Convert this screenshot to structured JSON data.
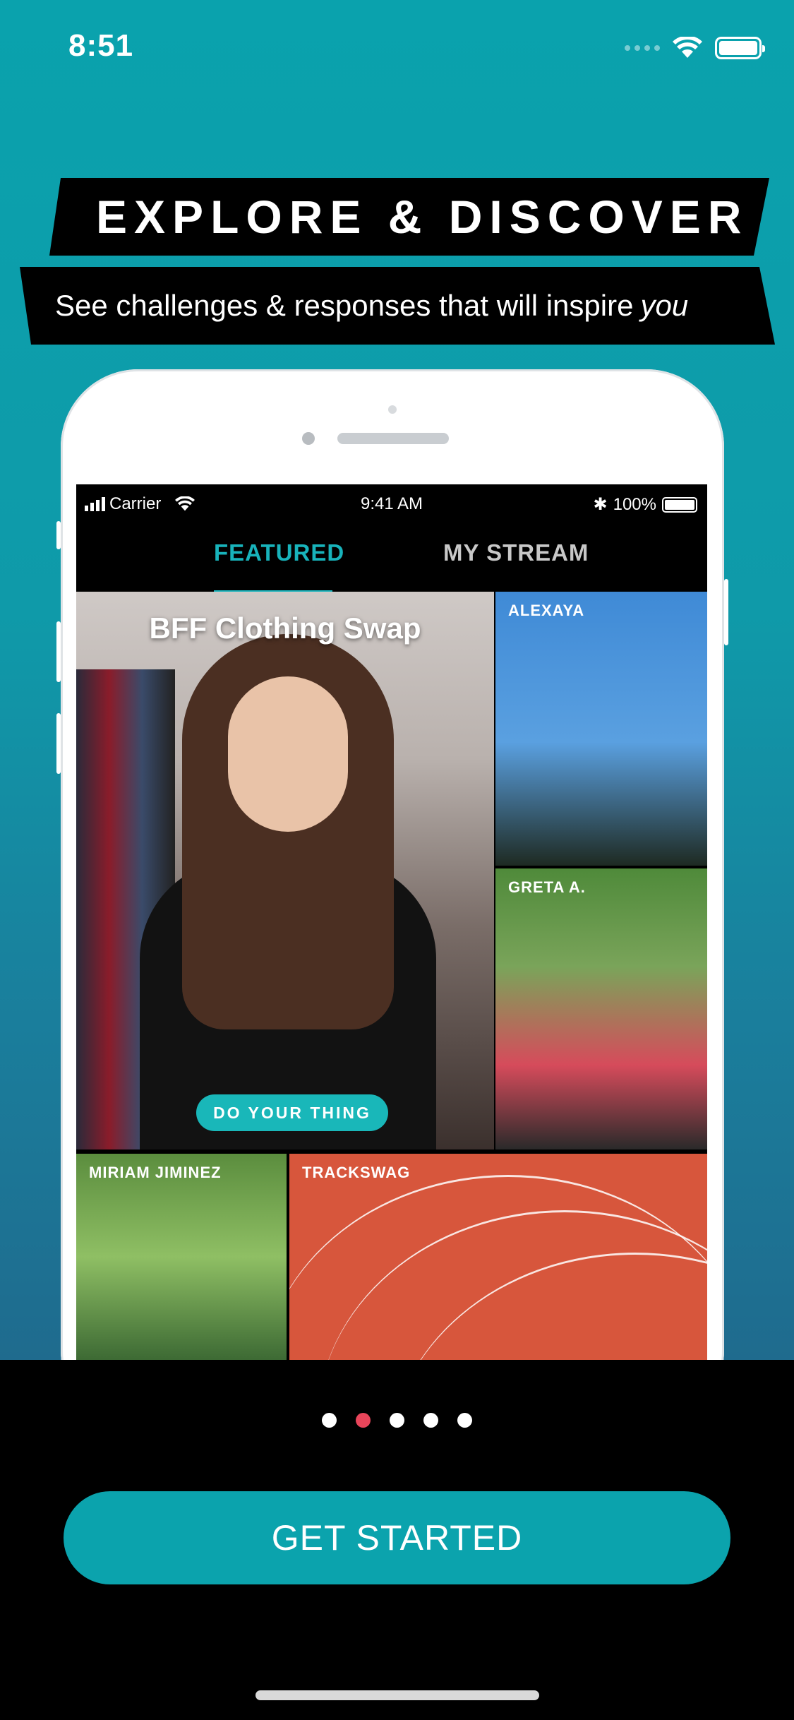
{
  "status_bar": {
    "time": "8:51"
  },
  "banner": {
    "title": "EXPLORE & DISCOVER",
    "subtitle": "See challenges & responses that will inspire",
    "subtitle_emphasis": "you"
  },
  "mockup": {
    "status": {
      "carrier": "Carrier",
      "time": "9:41 AM",
      "battery": "100%"
    },
    "tabs": [
      {
        "label": "FEATURED",
        "active": true
      },
      {
        "label": "MY STREAM",
        "active": false
      }
    ],
    "featured": {
      "title": "BFF Clothing Swap",
      "cta": "DO YOUR THING"
    },
    "tiles": [
      {
        "label": "ALEXAYA"
      },
      {
        "label": "GRETA A."
      },
      {
        "label": "MIRIAM JIMINEZ"
      },
      {
        "label": "TRACKSWAG"
      }
    ]
  },
  "pagination": {
    "count": 5,
    "active_index": 1,
    "active_color": "#e8455a"
  },
  "cta": {
    "label": "GET STARTED"
  },
  "colors": {
    "accent": "#0ba3ad",
    "tab_active": "#18b3bb"
  }
}
